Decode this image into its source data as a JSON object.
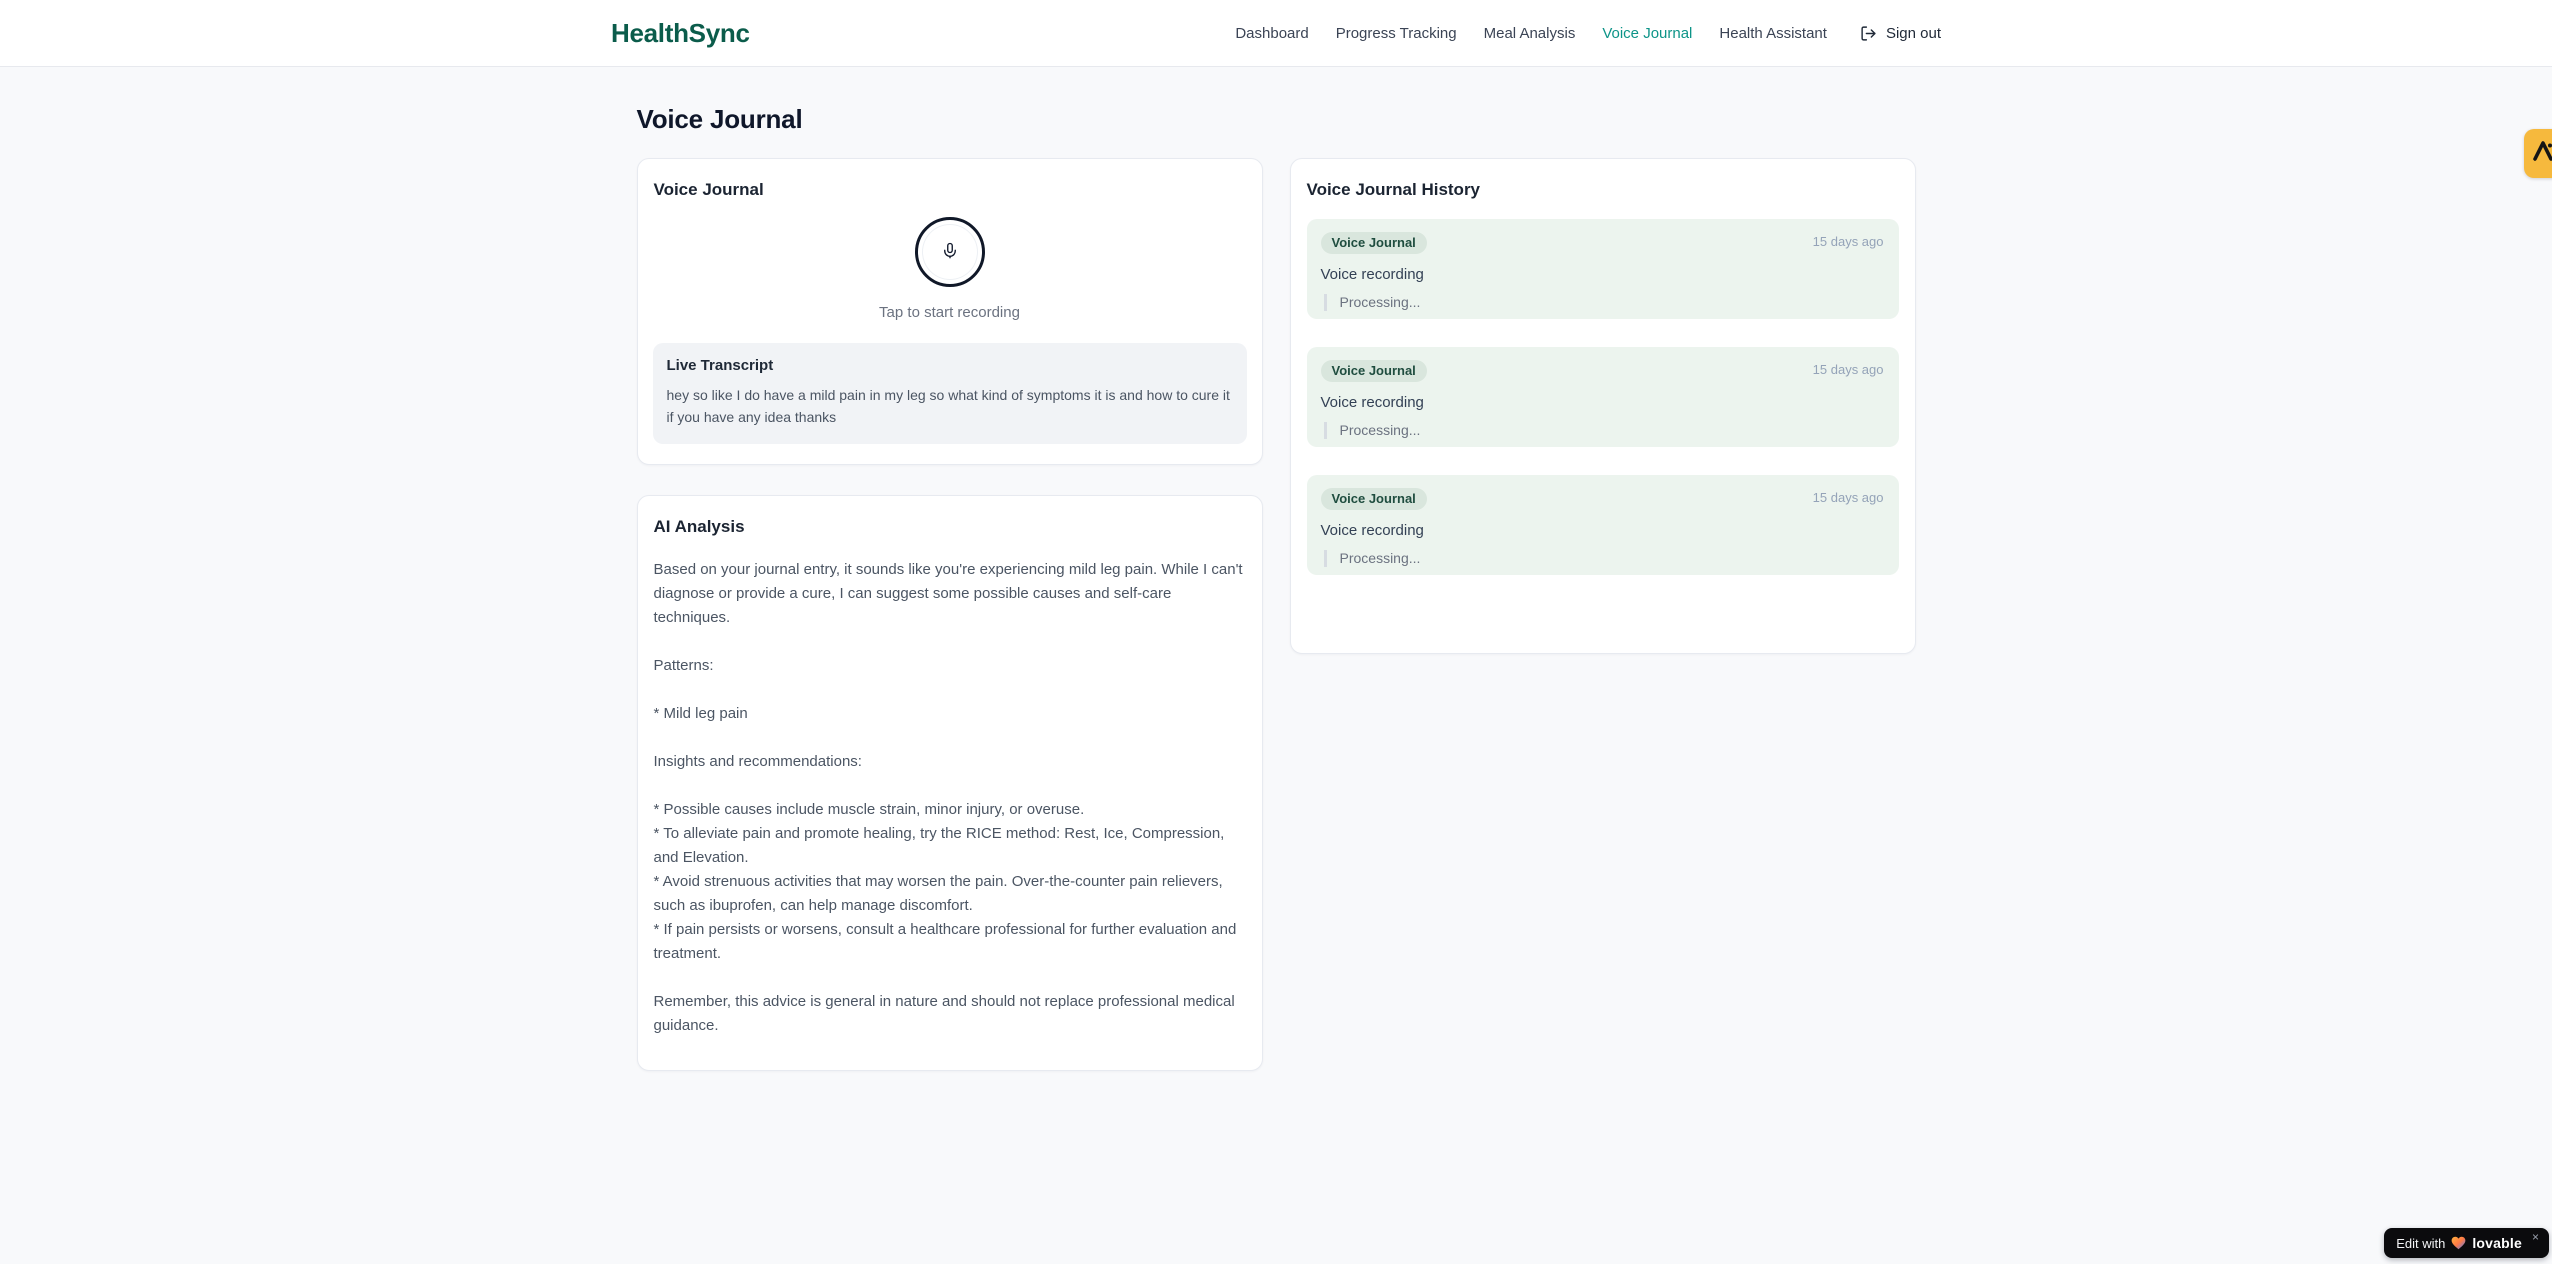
{
  "brand": {
    "name": "HealthSync"
  },
  "nav": {
    "items": [
      {
        "label": "Dashboard"
      },
      {
        "label": "Progress Tracking"
      },
      {
        "label": "Meal Analysis"
      },
      {
        "label": "Voice Journal"
      },
      {
        "label": "Health Assistant"
      }
    ],
    "active_item": "Voice Journal",
    "sign_out_label": "Sign out"
  },
  "page": {
    "title": "Voice Journal"
  },
  "recorder": {
    "card_title": "Voice Journal",
    "tap_label": "Tap to start recording",
    "transcript": {
      "title": "Live Transcript",
      "text": "hey so like I do have a mild pain in my leg so what kind of symptoms it is and how to cure it if you have any idea thanks"
    }
  },
  "analysis": {
    "title": "AI Analysis",
    "body": "Based on your journal entry, it sounds like you're experiencing mild leg pain. While I can't diagnose or provide a cure, I can suggest some possible causes and self-care techniques.\n\nPatterns:\n\n* Mild leg pain\n\nInsights and recommendations:\n\n* Possible causes include muscle strain, minor injury, or overuse.\n* To alleviate pain and promote healing, try the RICE method: Rest, Ice, Compression, and Elevation.\n* Avoid strenuous activities that may worsen the pain. Over-the-counter pain relievers, such as ibuprofen, can help manage discomfort.\n* If pain persists or worsens, consult a healthcare professional for further evaluation and treatment.\n\nRemember, this advice is general in nature and should not replace professional medical guidance."
  },
  "history": {
    "title": "Voice Journal History",
    "entries": [
      {
        "badge": "Voice Journal",
        "time": "15 days ago",
        "title": "Voice recording",
        "status": "Processing..."
      },
      {
        "badge": "Voice Journal",
        "time": "15 days ago",
        "title": "Voice recording",
        "status": "Processing..."
      },
      {
        "badge": "Voice Journal",
        "time": "15 days ago",
        "title": "Voice recording",
        "status": "Processing..."
      }
    ]
  },
  "widgets": {
    "lovable": {
      "prefix": "Edit with",
      "brand": "lovable",
      "close": "×"
    }
  },
  "colors": {
    "brand_green": "#0b5c4b",
    "active_nav_teal": "#0d9488",
    "page_bg": "#f8f9fb",
    "entry_bg": "#ecf4ee",
    "badge_bg": "#d9e6dd",
    "badge_text": "#1f4d3f",
    "edge_tab_amber": "#f6b93d",
    "lovable_black": "#0b0b0d"
  }
}
